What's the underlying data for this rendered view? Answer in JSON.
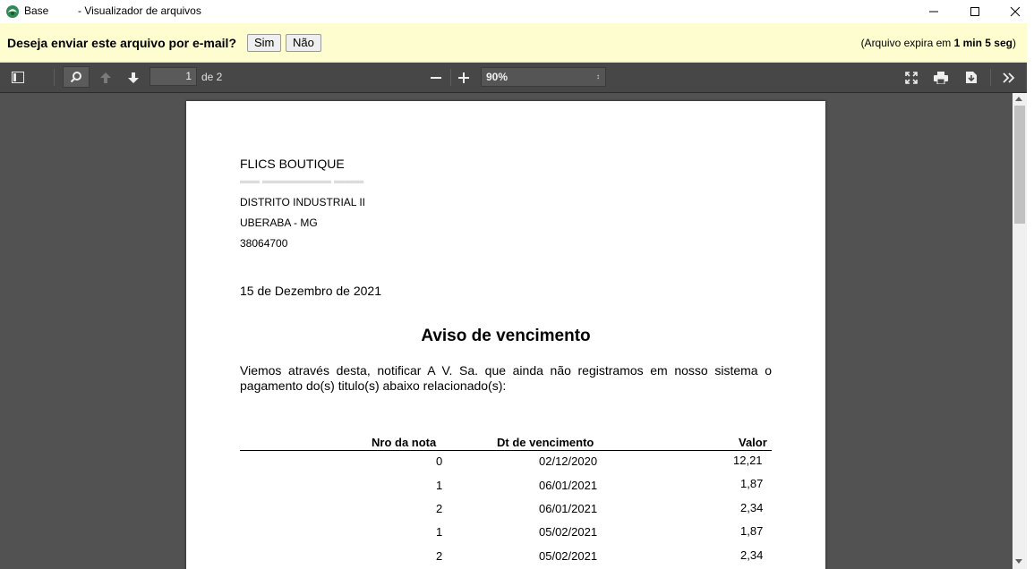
{
  "window": {
    "app_name": "Base",
    "title": "- Visualizador de arquivos"
  },
  "email_bar": {
    "question": "Deseja enviar este arquivo por e-mail?",
    "yes_label": "Sim",
    "no_label": "Não",
    "expiry_prefix": "(Arquivo expira em",
    "expiry_time": "1 min 5 seg",
    "expiry_suffix": ")"
  },
  "toolbar": {
    "current_page": "1",
    "page_of": "de 2",
    "zoom": "90%"
  },
  "document": {
    "company": "FLICS BOUTIQUE",
    "address_lines": [
      "DISTRITO INDUSTRIAL II",
      "UBERABA - MG",
      "38064700"
    ],
    "date": "15 de Dezembro de 2021",
    "title": "Aviso de vencimento",
    "body": "Viemos através desta, notificar A V. Sa. que ainda não registramos em nosso sistema o pagamento do(s) titulo(s) abaixo relacionado(s):",
    "table": {
      "headers": [
        "Nro da nota",
        "Dt de vencimento",
        "Valor"
      ],
      "rows": [
        [
          "0",
          "02/12/2020",
          "12,21"
        ],
        [
          "1",
          "06/01/2021",
          "1,87"
        ],
        [
          "2",
          "06/01/2021",
          "2,34"
        ],
        [
          "1",
          "05/02/2021",
          "1,87"
        ],
        [
          "2",
          "05/02/2021",
          "2,34"
        ]
      ]
    }
  }
}
